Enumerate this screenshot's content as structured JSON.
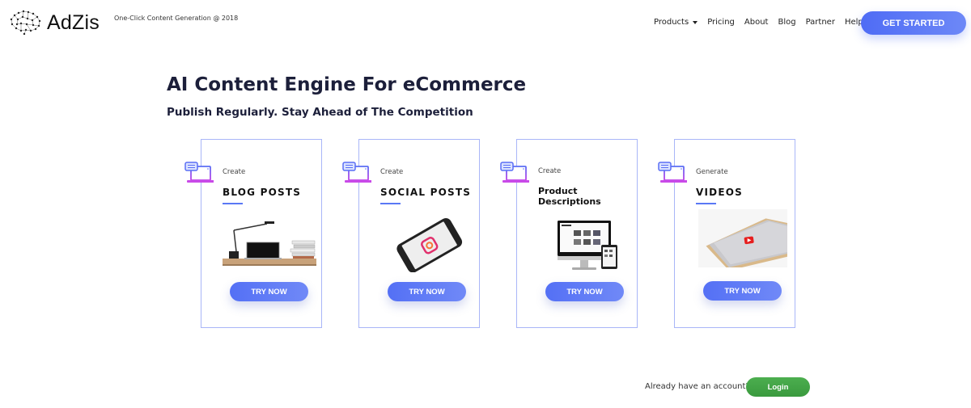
{
  "brand": {
    "name": "AdZis",
    "tagline": "One-Click Content Generation @ 2018",
    "logo_icon": "brain-network-icon"
  },
  "nav": {
    "items": [
      {
        "label": "Products",
        "has_dropdown": true
      },
      {
        "label": "Pricing"
      },
      {
        "label": "About"
      },
      {
        "label": "Blog"
      },
      {
        "label": "Partner"
      },
      {
        "label": "Help"
      }
    ],
    "cta_label": "GET STARTED"
  },
  "hero": {
    "title": "AI Content Engine For eCommerce",
    "subtitle": "Publish Regularly. Stay Ahead of The Competition"
  },
  "cards": [
    {
      "verb": "Create",
      "title": "BLOG POSTS",
      "image": "desk-laptop-lamp-image",
      "button": "TRY NOW"
    },
    {
      "verb": "Create",
      "title": "SOCIAL POSTS",
      "image": "phone-instagram-image",
      "button": "TRY NOW"
    },
    {
      "verb": "Create",
      "title_lines": [
        "Product",
        "Descriptions"
      ],
      "image": "desktop-tablet-store-image",
      "button": "TRY NOW"
    },
    {
      "verb": "Generate",
      "title": "VIDEOS",
      "image": "phone-youtube-image",
      "button": "TRY NOW"
    }
  ],
  "footer": {
    "prompt": "Already have an account?",
    "login_label": "Login"
  },
  "colors": {
    "accent": "#5470f5",
    "card_border": "#a9b6f8",
    "login_green": "#43a547",
    "text_dark": "#1c1f3a"
  }
}
